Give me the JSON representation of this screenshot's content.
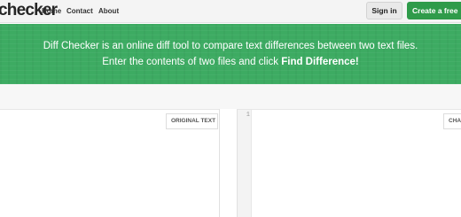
{
  "header": {
    "logo_text": "checker",
    "nav": [
      {
        "label": "Home"
      },
      {
        "label": "Contact"
      },
      {
        "label": "About"
      }
    ],
    "sign_in_label": "Sign in",
    "create_label": "Create a free"
  },
  "hero": {
    "line1": "Diff Checker is an online diff tool to compare text differences between two text files.",
    "line2_prefix": "Enter the contents of two files and click ",
    "line2_strong": "Find Difference!"
  },
  "editors": {
    "left": {
      "label": "ORIGINAL TEXT"
    },
    "right": {
      "label": "CHA",
      "line_number": "1"
    }
  },
  "colors": {
    "accent_green": "#3dab62",
    "button_green": "#2f9b4a"
  },
  "icons": []
}
